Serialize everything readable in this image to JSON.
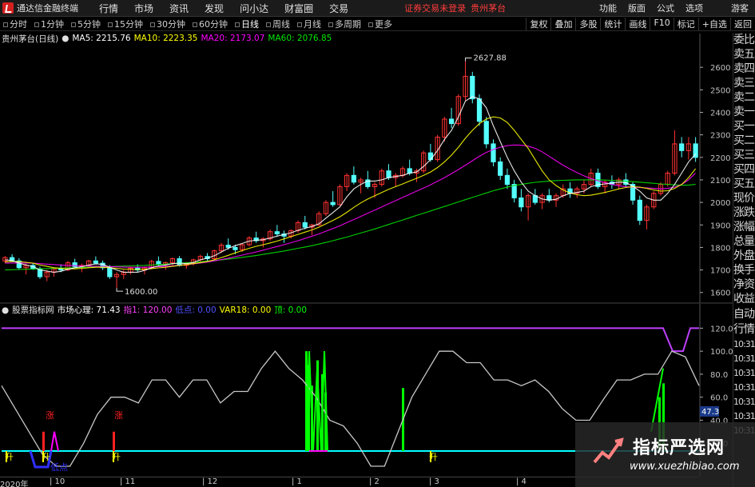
{
  "app": {
    "title": "通达信金融终端",
    "menu": [
      "行情",
      "市场",
      "资讯",
      "发现",
      "问小达",
      "财富圈",
      "交易"
    ],
    "promo": "证券交易未登录",
    "promo_stock": "贵州茅台",
    "right_menu": [
      "功能",
      "版面",
      "公式",
      "选项"
    ],
    "guest": "游客"
  },
  "periods": [
    "分时",
    "1分钟",
    "5分钟",
    "15分钟",
    "30分钟",
    "60分钟",
    "日线",
    "周线",
    "月线",
    "多周期",
    "更多"
  ],
  "active_period": "日线",
  "tools": [
    "复权",
    "叠加",
    "多股",
    "统计",
    "画线",
    "F10",
    "标记",
    "+自选",
    "返回"
  ],
  "main_legend": {
    "stock": "贵州茅台(日线)",
    "ma5": "MA5: 2215.76",
    "ma10": "MA10: 2223.35",
    "ma20": "MA20: 2173.07",
    "ma60": "MA60: 2076.85"
  },
  "colors": {
    "up": "#ff3232",
    "down": "#54ffff",
    "ma5": "#ffffff",
    "ma10": "#ffff00",
    "ma20": "#ff00ff",
    "ma60": "#00e600",
    "axis": "#c0c0c0",
    "indicator_line": "#c8c8c8",
    "green_bar": "#00ff00",
    "red_bar": "#ff2020",
    "magenta": "#ff00ff",
    "yellow": "#ffff00",
    "blue": "#3030ff",
    "cyan_band": "#00ffff",
    "purple_line": "#c040ff"
  },
  "sidebar": [
    "委比",
    "卖五",
    "卖四",
    "卖三",
    "卖二",
    "卖一",
    "买一",
    "买二",
    "买三",
    "买四",
    "买五",
    "现价",
    "涨跌",
    "涨幅",
    "总量",
    "外盘",
    "换手",
    "净资",
    "收益"
  ],
  "sidebar_lower": [
    "自动",
    "行情",
    "10:31",
    "10:31",
    "10:31",
    "10:31",
    "10:31",
    "10:31",
    "10:31"
  ],
  "indicator_legend": {
    "name": "股票指标网",
    "psy": "市场心理: 71.43",
    "zhi1": "指1: 120.00",
    "low": "低点: 0.00",
    "var18": "VAR18: 0.00",
    "ding": "顶: 0.00"
  },
  "annotations": {
    "high_label": "2627.88",
    "low_label": "1600.00",
    "zhang": "涨",
    "sheng": "升",
    "didian": "低点",
    "current_value": "47.3"
  },
  "watermark": {
    "cn": "指标严选网",
    "url": "www.xuezhibiao.com"
  },
  "chart_data": [
    {
      "type": "candlestick",
      "title": "贵州茅台(日线)",
      "ylim": [
        1560,
        2700
      ],
      "y_ticks": [
        1600,
        1700,
        1800,
        1900,
        2000,
        2100,
        2200,
        2300,
        2400,
        2500,
        2600
      ],
      "x_ticks": [
        "2020年",
        "10",
        "11",
        "12",
        "1",
        "2",
        "3",
        "4"
      ],
      "candles": [
        [
          1740,
          1762,
          1730,
          1755
        ],
        [
          1755,
          1770,
          1735,
          1740
        ],
        [
          1740,
          1752,
          1700,
          1710
        ],
        [
          1710,
          1728,
          1680,
          1720
        ],
        [
          1720,
          1732,
          1700,
          1705
        ],
        [
          1705,
          1715,
          1660,
          1670
        ],
        [
          1670,
          1700,
          1650,
          1690
        ],
        [
          1690,
          1712,
          1670,
          1705
        ],
        [
          1705,
          1725,
          1690,
          1700
        ],
        [
          1700,
          1740,
          1695,
          1732
        ],
        [
          1732,
          1750,
          1710,
          1715
        ],
        [
          1715,
          1728,
          1690,
          1720
        ],
        [
          1720,
          1745,
          1712,
          1740
        ],
        [
          1740,
          1760,
          1725,
          1730
        ],
        [
          1730,
          1742,
          1700,
          1710
        ],
        [
          1710,
          1722,
          1660,
          1670
        ],
        [
          1670,
          1690,
          1620,
          1680
        ],
        [
          1680,
          1700,
          1660,
          1690
        ],
        [
          1690,
          1715,
          1680,
          1708
        ],
        [
          1708,
          1725,
          1690,
          1700
        ],
        [
          1700,
          1715,
          1680,
          1710
        ],
        [
          1710,
          1745,
          1705,
          1738
        ],
        [
          1738,
          1760,
          1720,
          1725
        ],
        [
          1725,
          1738,
          1700,
          1732
        ],
        [
          1732,
          1755,
          1720,
          1750
        ],
        [
          1750,
          1762,
          1715,
          1720
        ],
        [
          1720,
          1735,
          1705,
          1730
        ],
        [
          1730,
          1750,
          1720,
          1745
        ],
        [
          1745,
          1768,
          1735,
          1760
        ],
        [
          1760,
          1775,
          1740,
          1750
        ],
        [
          1750,
          1790,
          1745,
          1785
        ],
        [
          1785,
          1820,
          1775,
          1810
        ],
        [
          1810,
          1840,
          1790,
          1800
        ],
        [
          1800,
          1812,
          1770,
          1790
        ],
        [
          1790,
          1818,
          1780,
          1812
        ],
        [
          1812,
          1850,
          1805,
          1842
        ],
        [
          1842,
          1870,
          1820,
          1830
        ],
        [
          1830,
          1845,
          1800,
          1838
        ],
        [
          1838,
          1880,
          1830,
          1870
        ],
        [
          1870,
          1900,
          1850,
          1860
        ],
        [
          1860,
          1875,
          1820,
          1850
        ],
        [
          1850,
          1880,
          1840,
          1875
        ],
        [
          1875,
          1920,
          1865,
          1910
        ],
        [
          1910,
          1940,
          1880,
          1890
        ],
        [
          1890,
          1905,
          1855,
          1900
        ],
        [
          1900,
          1960,
          1895,
          1950
        ],
        [
          1950,
          2010,
          1940,
          2000
        ],
        [
          2000,
          2050,
          1980,
          1990
        ],
        [
          1990,
          2080,
          1985,
          2070
        ],
        [
          2070,
          2130,
          2050,
          2120
        ],
        [
          2120,
          2160,
          2080,
          2090
        ],
        [
          2090,
          2110,
          2040,
          2100
        ],
        [
          2100,
          2140,
          2060,
          2070
        ],
        [
          2070,
          2090,
          2020,
          2080
        ],
        [
          2080,
          2150,
          2070,
          2140
        ],
        [
          2140,
          2170,
          2100,
          2110
        ],
        [
          2110,
          2130,
          2070,
          2120
        ],
        [
          2120,
          2160,
          2110,
          2150
        ],
        [
          2150,
          2190,
          2120,
          2130
        ],
        [
          2130,
          2150,
          2090,
          2140
        ],
        [
          2140,
          2230,
          2130,
          2220
        ],
        [
          2220,
          2260,
          2180,
          2190
        ],
        [
          2190,
          2300,
          2180,
          2290
        ],
        [
          2290,
          2380,
          2270,
          2370
        ],
        [
          2370,
          2420,
          2330,
          2350
        ],
        [
          2350,
          2480,
          2340,
          2470
        ],
        [
          2470,
          2627,
          2450,
          2560
        ],
        [
          2560,
          2580,
          2440,
          2460
        ],
        [
          2460,
          2480,
          2340,
          2360
        ],
        [
          2360,
          2380,
          2240,
          2260
        ],
        [
          2260,
          2280,
          2160,
          2180
        ],
        [
          2180,
          2200,
          2100,
          2120
        ],
        [
          2120,
          2150,
          2060,
          2080
        ],
        [
          2080,
          2100,
          2000,
          2020
        ],
        [
          2020,
          2060,
          1960,
          1980
        ],
        [
          1980,
          2040,
          1920,
          2030
        ],
        [
          2030,
          2060,
          1990,
          2000
        ],
        [
          2000,
          2040,
          1970,
          2030
        ],
        [
          2030,
          2060,
          2000,
          2010
        ],
        [
          2010,
          2040,
          1980,
          2030
        ],
        [
          2030,
          2080,
          2020,
          2060
        ],
        [
          2060,
          2090,
          2020,
          2040
        ],
        [
          2040,
          2070,
          2020,
          2060
        ],
        [
          2060,
          2100,
          2040,
          2080
        ],
        [
          2080,
          2150,
          2070,
          2130
        ],
        [
          2130,
          2150,
          2060,
          2070
        ],
        [
          2070,
          2100,
          2040,
          2090
        ],
        [
          2090,
          2120,
          2060,
          2080
        ],
        [
          2080,
          2110,
          2060,
          2100
        ],
        [
          2100,
          2130,
          2070,
          2080
        ],
        [
          2080,
          2090,
          1990,
          2010
        ],
        [
          2010,
          2030,
          1900,
          1920
        ],
        [
          1920,
          1990,
          1880,
          1980
        ],
        [
          1980,
          2050,
          1970,
          2040
        ],
        [
          2040,
          2090,
          2030,
          2080
        ],
        [
          2080,
          2140,
          2070,
          2130
        ],
        [
          2130,
          2320,
          2120,
          2260
        ],
        [
          2260,
          2290,
          2200,
          2230
        ],
        [
          2230,
          2290,
          2190,
          2260
        ],
        [
          2260,
          2290,
          2180,
          2200
        ]
      ],
      "ma5": [
        1745,
        1742,
        1730,
        1722,
        1716,
        1700,
        1695,
        1690,
        1694,
        1703,
        1710,
        1714,
        1722,
        1727,
        1725,
        1712,
        1700,
        1690,
        1690,
        1690,
        1698,
        1710,
        1718,
        1722,
        1728,
        1730,
        1728,
        1733,
        1745,
        1752,
        1763,
        1780,
        1796,
        1808,
        1818,
        1828,
        1832,
        1834,
        1842,
        1850,
        1858,
        1865,
        1876,
        1885,
        1893,
        1905,
        1930,
        1955,
        1980,
        2025,
        2060,
        2080,
        2095,
        2095,
        2100,
        2110,
        2115,
        2120,
        2130,
        2135,
        2160,
        2190,
        2230,
        2280,
        2320,
        2380,
        2450,
        2470,
        2460,
        2420,
        2340,
        2270,
        2200,
        2140,
        2090,
        2050,
        2030,
        2015,
        2010,
        2014,
        2030,
        2040,
        2044,
        2050,
        2070,
        2078,
        2082,
        2086,
        2090,
        2088,
        2072,
        2050,
        2020,
        2010,
        2010,
        2040,
        2080,
        2130,
        2180,
        2215
      ],
      "ma10": [
        1735,
        1738,
        1737,
        1734,
        1730,
        1722,
        1716,
        1710,
        1707,
        1705,
        1705,
        1707,
        1710,
        1712,
        1712,
        1710,
        1707,
        1704,
        1703,
        1702,
        1703,
        1706,
        1709,
        1712,
        1716,
        1720,
        1724,
        1728,
        1733,
        1738,
        1745,
        1755,
        1765,
        1776,
        1786,
        1796,
        1805,
        1812,
        1820,
        1828,
        1838,
        1848,
        1858,
        1868,
        1878,
        1890,
        1905,
        1920,
        1936,
        1956,
        1978,
        1998,
        2015,
        2030,
        2044,
        2058,
        2070,
        2082,
        2095,
        2107,
        2120,
        2135,
        2155,
        2180,
        2210,
        2245,
        2285,
        2320,
        2350,
        2370,
        2380,
        2375,
        2355,
        2320,
        2280,
        2240,
        2190,
        2140,
        2100,
        2075,
        2055,
        2042,
        2034,
        2030,
        2032,
        2038,
        2044,
        2052,
        2060,
        2066,
        2070,
        2068,
        2062,
        2055,
        2050,
        2052,
        2062,
        2080,
        2110,
        2150
      ],
      "ma20": [
        1730,
        1731,
        1731,
        1731,
        1730,
        1728,
        1726,
        1724,
        1722,
        1720,
        1719,
        1718,
        1717,
        1716,
        1716,
        1715,
        1714,
        1713,
        1712,
        1712,
        1712,
        1713,
        1714,
        1716,
        1718,
        1721,
        1724,
        1727,
        1731,
        1735,
        1740,
        1746,
        1752,
        1759,
        1766,
        1773,
        1780,
        1788,
        1796,
        1804,
        1812,
        1821,
        1830,
        1840,
        1850,
        1860,
        1872,
        1884,
        1896,
        1910,
        1924,
        1938,
        1952,
        1966,
        1980,
        1994,
        2008,
        2022,
        2036,
        2050,
        2064,
        2078,
        2094,
        2110,
        2128,
        2146,
        2165,
        2185,
        2205,
        2222,
        2235,
        2245,
        2252,
        2255,
        2254,
        2250,
        2240,
        2225,
        2205,
        2185,
        2165,
        2148,
        2132,
        2118,
        2106,
        2096,
        2088,
        2080,
        2074,
        2070,
        2068,
        2066,
        2064,
        2062,
        2060,
        2062,
        2068,
        2080,
        2100,
        2130
      ],
      "ma60": [
        1700,
        1701,
        1702,
        1703,
        1704,
        1705,
        1706,
        1707,
        1708,
        1709,
        1710,
        1711,
        1712,
        1713,
        1714,
        1715,
        1716,
        1717,
        1718,
        1719,
        1720,
        1722,
        1724,
        1726,
        1728,
        1730,
        1732,
        1734,
        1736,
        1739,
        1742,
        1745,
        1748,
        1752,
        1756,
        1760,
        1764,
        1769,
        1774,
        1779,
        1784,
        1790,
        1796,
        1802,
        1808,
        1815,
        1822,
        1830,
        1838,
        1846,
        1855,
        1864,
        1873,
        1882,
        1892,
        1902,
        1912,
        1922,
        1932,
        1942,
        1952,
        1962,
        1972,
        1982,
        1992,
        2002,
        2012,
        2022,
        2032,
        2042,
        2052,
        2060,
        2068,
        2075,
        2080,
        2085,
        2089,
        2092,
        2095,
        2097,
        2098,
        2099,
        2100,
        2100,
        2100,
        2100,
        2099,
        2098,
        2096,
        2094,
        2092,
        2090,
        2087,
        2085,
        2082,
        2080,
        2078,
        2076,
        2077,
        2080
      ]
    },
    {
      "type": "line",
      "title": "股票指标网",
      "ylim": [
        0,
        130
      ],
      "y_ticks": [
        20,
        40,
        60,
        80,
        100,
        120
      ],
      "series": [
        {
          "name": "市场心理",
          "values": [
            70,
            50,
            30,
            10,
            0,
            0,
            20,
            45,
            60,
            60,
            55,
            75,
            75,
            60,
            75,
            75,
            55,
            65,
            65,
            85,
            100,
            85,
            75,
            60,
            40,
            35,
            20,
            0,
            0,
            30,
            60,
            80,
            100,
            100,
            90,
            90,
            75,
            75,
            70,
            75,
            65,
            50,
            40,
            40,
            58,
            75,
            75,
            80,
            80,
            100,
            95,
            70
          ]
        },
        {
          "name": "指1",
          "values": [
            120,
            120,
            120,
            120,
            120,
            120,
            120,
            120,
            120,
            120,
            120,
            120,
            120,
            120,
            120,
            120,
            120,
            120,
            120,
            120,
            120,
            120,
            120,
            120,
            120,
            120,
            120,
            120,
            120,
            120,
            120,
            120,
            120,
            120,
            120,
            120,
            120,
            120,
            120,
            120,
            120,
            120,
            120,
            120,
            120,
            120,
            120,
            120,
            120,
            120,
            120,
            120
          ]
        }
      ]
    }
  ]
}
